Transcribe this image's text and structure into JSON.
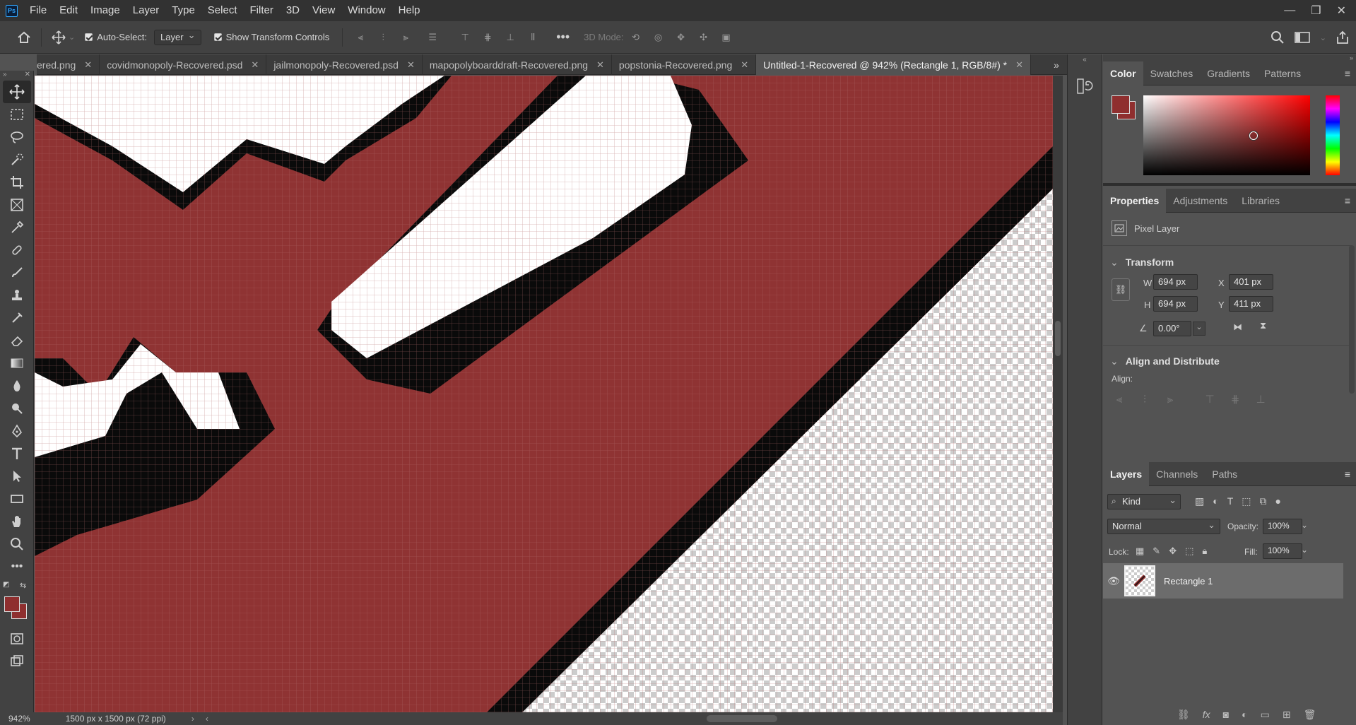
{
  "menu": [
    "File",
    "Edit",
    "Image",
    "Layer",
    "Type",
    "Select",
    "Filter",
    "3D",
    "View",
    "Window",
    "Help"
  ],
  "app_logo": "Ps",
  "options": {
    "auto_select_label": "Auto-Select:",
    "auto_select_value": "Layer",
    "show_transform_label": "Show Transform Controls",
    "mode_3d_label": "3D Mode:"
  },
  "tabs": [
    {
      "label": "ered.png"
    },
    {
      "label": "covidmonopoly-Recovered.psd"
    },
    {
      "label": "jailmonopoly-Recovered.psd"
    },
    {
      "label": "mapopolyboarddraft-Recovered.png"
    },
    {
      "label": "popstonia-Recovered.png"
    },
    {
      "label": "Untitled-1-Recovered @ 942% (Rectangle 1, RGB/8#) *"
    }
  ],
  "status": {
    "zoom": "942%",
    "doc_size": "1500 px x 1500 px (72 ppi)"
  },
  "colors": {
    "foreground": "#8f2f2f",
    "background": "#8f2f2f",
    "canvas_red": "#8f3333"
  },
  "color_panel": {
    "tabs": [
      "Color",
      "Swatches",
      "Gradients",
      "Patterns"
    ]
  },
  "properties_panel": {
    "tabs": [
      "Properties",
      "Adjustments",
      "Libraries"
    ],
    "layer_type": "Pixel Layer",
    "transform_title": "Transform",
    "w_label": "W",
    "w_value": "694 px",
    "h_label": "H",
    "h_value": "694 px",
    "x_label": "X",
    "x_value": "401 px",
    "y_label": "Y",
    "y_value": "411 px",
    "angle_value": "0.00°",
    "align_title": "Align and Distribute",
    "align_label": "Align:"
  },
  "layers_panel": {
    "tabs": [
      "Layers",
      "Channels",
      "Paths"
    ],
    "filter_kind": "Kind",
    "blend_mode": "Normal",
    "opacity_label": "Opacity:",
    "opacity_value": "100%",
    "lock_label": "Lock:",
    "fill_label": "Fill:",
    "fill_value": "100%",
    "layer_name": "Rectangle 1"
  }
}
